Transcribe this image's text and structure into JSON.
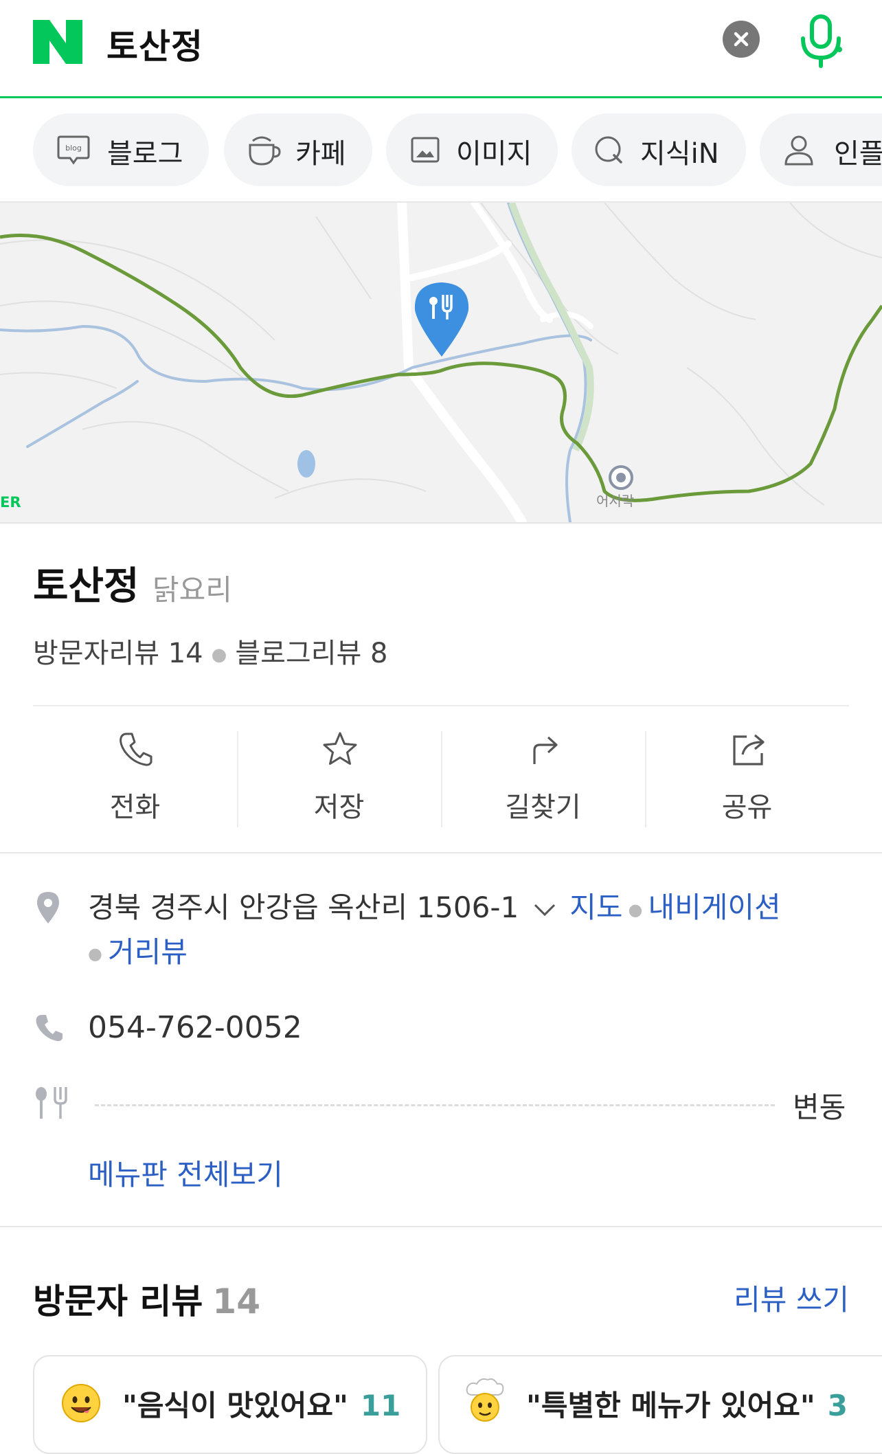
{
  "search": {
    "query": "토산정",
    "clear_icon": "close-icon",
    "mic_icon": "mic-icon"
  },
  "colors": {
    "brand": "#03c75a",
    "link": "#2c5fc4",
    "marker": "#3d8fe0",
    "trail": "#6a9a3a",
    "count": "#3a9f9a"
  },
  "tabs": [
    {
      "label": "블로그",
      "icon": "blog-icon"
    },
    {
      "label": "카페",
      "icon": "cafe-icon"
    },
    {
      "label": "이미지",
      "icon": "image-icon"
    },
    {
      "label": "지식iN",
      "icon": "kin-icon"
    },
    {
      "label": "인플",
      "icon": "person-icon"
    }
  ],
  "map": {
    "poi_label": "어서락",
    "logo_text": "ER",
    "marker_icon": "restaurant-marker-icon"
  },
  "place": {
    "name": "토산정",
    "category": "닭요리",
    "visitor_reviews": "방문자리뷰 14",
    "blog_reviews": "블로그리뷰 8"
  },
  "actions": [
    {
      "label": "전화",
      "icon": "phone-icon"
    },
    {
      "label": "저장",
      "icon": "star-icon"
    },
    {
      "label": "길찾기",
      "icon": "directions-icon"
    },
    {
      "label": "공유",
      "icon": "share-icon"
    }
  ],
  "details": {
    "address": "경북 경주시 안강읍 옥산리 1506-1",
    "address_links": [
      "지도",
      "내비게이션",
      "거리뷰"
    ],
    "phone": "054-762-0052",
    "menu_price": "변동",
    "menu_link": "메뉴판 전체보기"
  },
  "reviews_section": {
    "title": "방문자 리뷰",
    "count": "14",
    "write_label": "리뷰 쓰기",
    "chips": [
      {
        "text": "\"음식이 맛있어요\"",
        "count": "11",
        "icon": "smiley-emoji-icon"
      },
      {
        "text": "\"특별한 메뉴가 있어요\"",
        "count": "3",
        "icon": "chef-emoji-icon"
      }
    ]
  }
}
